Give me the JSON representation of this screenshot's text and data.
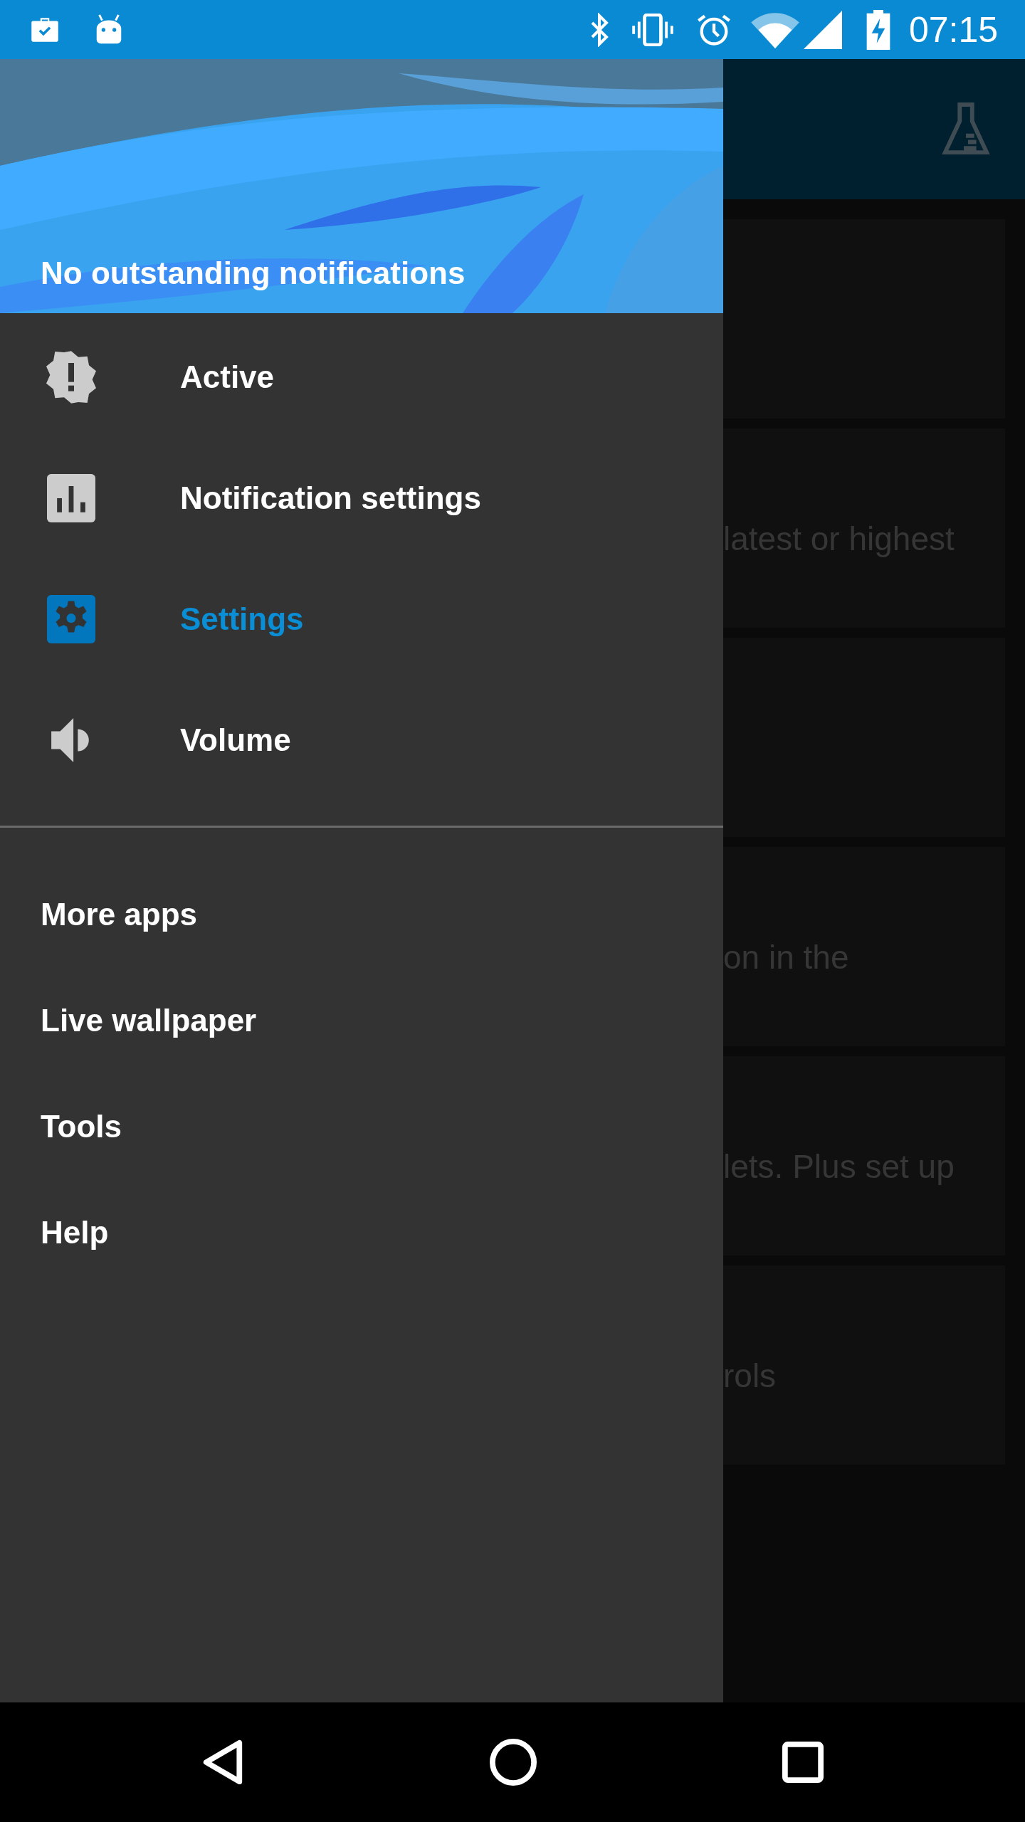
{
  "status_bar": {
    "time": "07:15"
  },
  "drawer": {
    "header_title": "No outstanding notifications",
    "nav_items": [
      {
        "label": "Active",
        "kind": "alert",
        "selected": false
      },
      {
        "label": "Notification settings",
        "kind": "chart",
        "selected": false
      },
      {
        "label": "Settings",
        "kind": "gear",
        "selected": true
      },
      {
        "label": "Volume",
        "kind": "speaker",
        "selected": false
      }
    ],
    "secondary_items": [
      "More apps",
      "Live wallpaper",
      "Tools",
      "Help"
    ]
  },
  "background_cards": [
    {
      "kind": "blank"
    },
    {
      "kind": "text",
      "text": "latest or highest"
    },
    {
      "kind": "blank"
    },
    {
      "kind": "text",
      "text": "on in the"
    },
    {
      "kind": "text",
      "text": "lets. Plus set up"
    },
    {
      "kind": "text",
      "text": "rols"
    }
  ]
}
